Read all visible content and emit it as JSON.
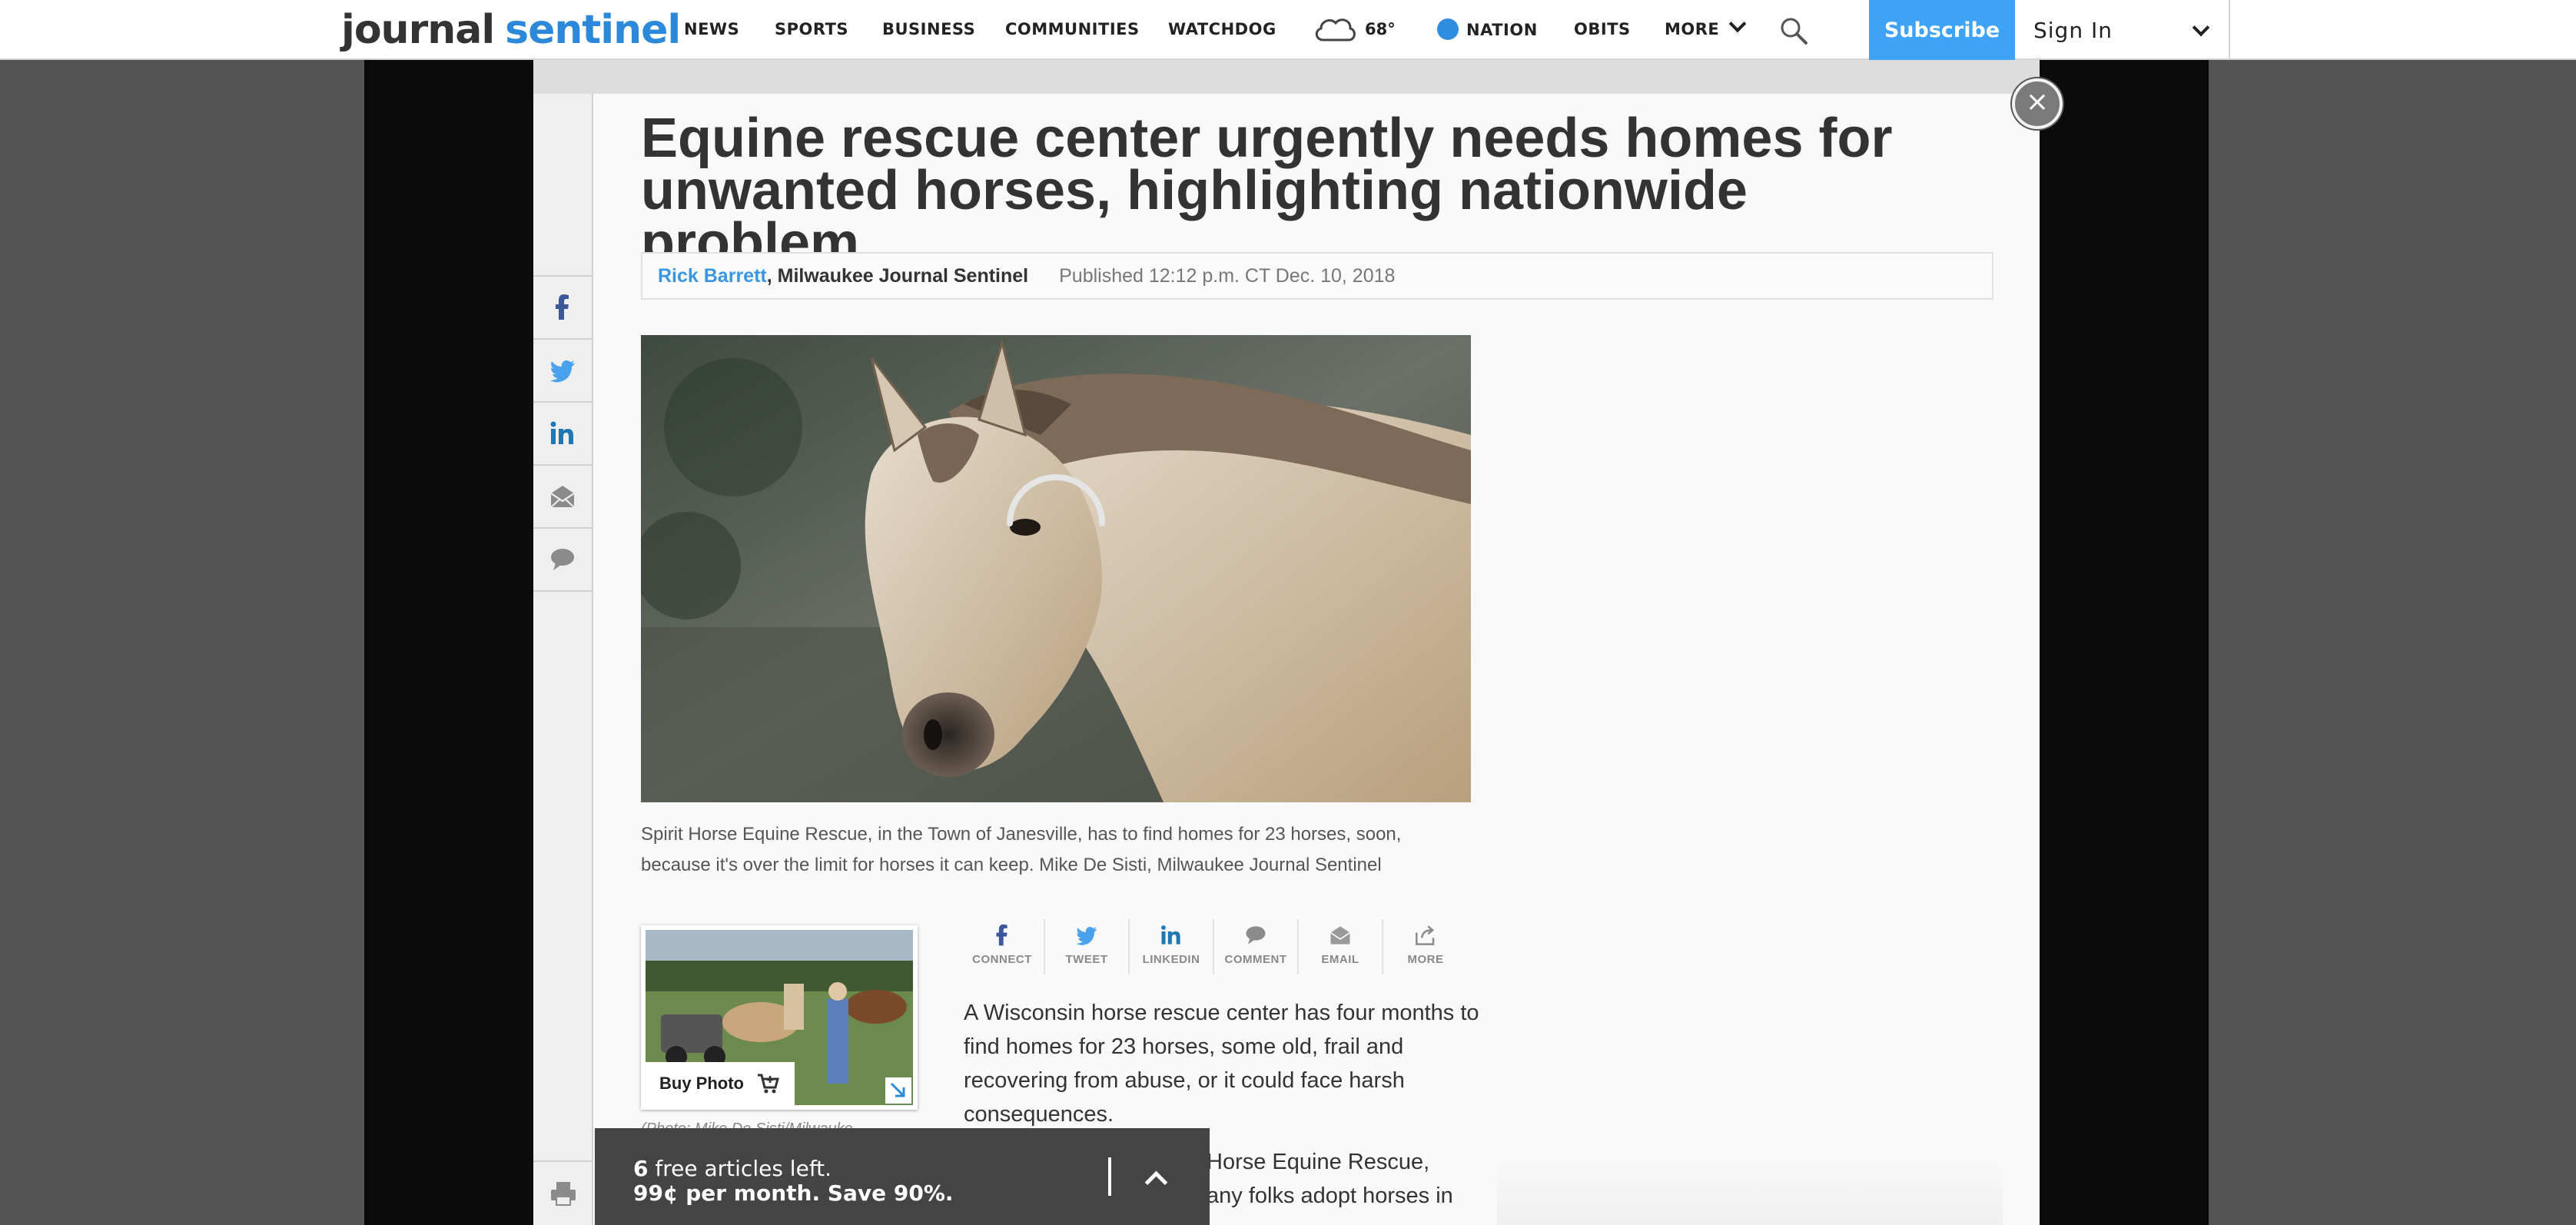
{
  "nav": {
    "logo_word1": "journal",
    "logo_word2": "sentinel",
    "items": [
      "NEWS",
      "SPORTS",
      "BUSINESS",
      "COMMUNITIES",
      "WATCHDOG"
    ],
    "weather_temp": "68°",
    "nation": "NATION",
    "obits": "OBITS",
    "more": "MORE",
    "subscribe": "Subscribe",
    "sign_in": "Sign In",
    "accent_color": "#3ea2f5"
  },
  "article": {
    "headline": "Equine rescue center urgently needs homes for unwanted horses, highlighting nationwide problem",
    "author": "Rick Barrett",
    "org": ", Milwaukee Journal Sentinel",
    "published": "Published 12:12 p.m. CT Dec. 10, 2018",
    "caption": "Spirit Horse Equine Rescue, in the Town of Janesville, has to find homes for 23 horses, soon, because it's over the limit for horses it can keep. Mike De Sisti, Milwaukee Journal Sentinel",
    "buy_photo": "Buy Photo",
    "thumb_credit": "(Photo: Mike De Sisti/Milwauke",
    "paragraph1": "A Wisconsin horse rescue center has four months to find homes for 23 horses, some old, frail and recovering from abuse, or it could face harsh consequences.",
    "paragraph2_part1": "Horse Equine Rescue,",
    "paragraph2_part2": "any folks adopt horses in"
  },
  "share_bar": {
    "connect": "CONNECT",
    "tweet": "TWEET",
    "linkedin": "LINKEDIN",
    "comment": "COMMENT",
    "email": "EMAIL",
    "more": "MORE"
  },
  "rail_icons": [
    "facebook-icon",
    "twitter-icon",
    "linkedin-icon",
    "email-icon",
    "comment-icon",
    "print-icon"
  ],
  "paywall": {
    "count": "6",
    "line1_rest": " free articles left.",
    "line2": "99¢ per month. Save 90%."
  }
}
